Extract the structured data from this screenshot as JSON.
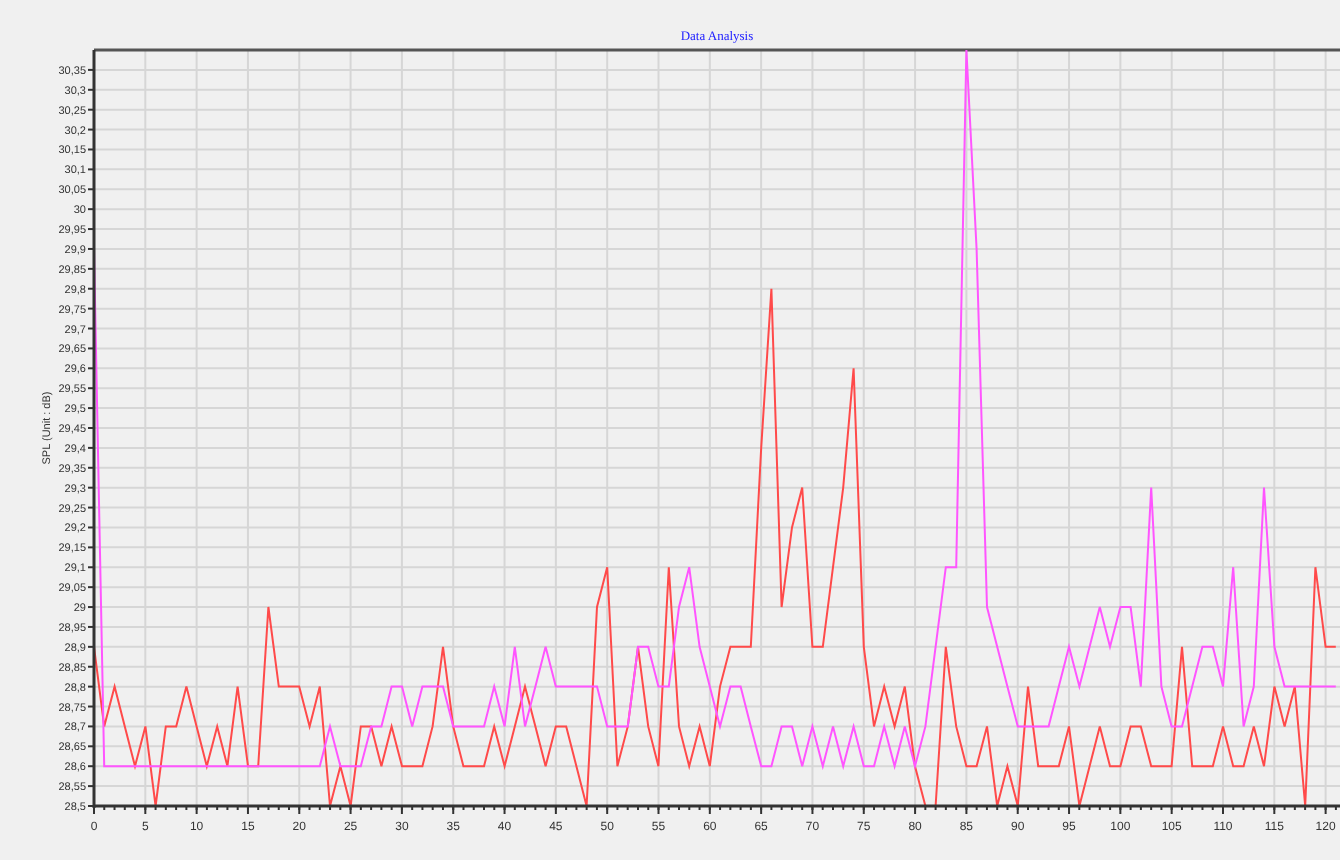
{
  "chart": {
    "chart_data": {
      "type": "line",
      "grid": true,
      "title": "Data Analysis",
      "ylabel": "SPL (Unit : dB)",
      "x": [
        0,
        1,
        2,
        3,
        4,
        5,
        6,
        7,
        8,
        9,
        10,
        11,
        12,
        13,
        14,
        15,
        16,
        17,
        18,
        19,
        20,
        21,
        22,
        23,
        24,
        25,
        26,
        27,
        28,
        29,
        30,
        31,
        32,
        33,
        34,
        35,
        36,
        37,
        38,
        39,
        40,
        41,
        42,
        43,
        44,
        45,
        46,
        47,
        48,
        49,
        50,
        51,
        52,
        53,
        54,
        55,
        56,
        57,
        58,
        59,
        60,
        61,
        62,
        63,
        64,
        65,
        66,
        67,
        68,
        69,
        70,
        71,
        72,
        73,
        74,
        75,
        76,
        77,
        78,
        79,
        80,
        81,
        82,
        83,
        84,
        85,
        86,
        87,
        88,
        89,
        90,
        91,
        92,
        93,
        94,
        95,
        96,
        97,
        98,
        99,
        100,
        101,
        102,
        103,
        104,
        105,
        106,
        107,
        108,
        109,
        110,
        111,
        112,
        113,
        114,
        115,
        116,
        117,
        118,
        119,
        120,
        121
      ],
      "series": [
        {
          "color": "#ff4a4a",
          "values": [
            28.9,
            28.7,
            28.8,
            28.7,
            28.6,
            28.7,
            28.5,
            28.7,
            28.7,
            28.8,
            28.7,
            28.6,
            28.7,
            28.6,
            28.8,
            28.6,
            28.6,
            29.0,
            28.8,
            28.8,
            28.8,
            28.7,
            28.8,
            28.5,
            28.6,
            28.5,
            28.7,
            28.7,
            28.6,
            28.7,
            28.6,
            28.6,
            28.6,
            28.7,
            28.9,
            28.7,
            28.6,
            28.6,
            28.6,
            28.7,
            28.6,
            28.7,
            28.8,
            28.7,
            28.6,
            28.7,
            28.7,
            28.6,
            28.5,
            29.0,
            29.1,
            28.6,
            28.7,
            28.9,
            28.7,
            28.6,
            29.1,
            28.7,
            28.6,
            28.7,
            28.6,
            28.8,
            28.9,
            28.9,
            28.9,
            29.4,
            29.8,
            29.0,
            29.2,
            29.3,
            28.9,
            28.9,
            29.1,
            29.3,
            29.6,
            28.9,
            28.7,
            28.8,
            28.7,
            28.8,
            28.6,
            28.5,
            28.5,
            28.9,
            28.7,
            28.6,
            28.6,
            28.7,
            28.5,
            28.6,
            28.5,
            28.8,
            28.6,
            28.6,
            28.6,
            28.7,
            28.5,
            28.6,
            28.7,
            28.6,
            28.6,
            28.7,
            28.7,
            28.6,
            28.6,
            28.6,
            28.9,
            28.6,
            28.6,
            28.6,
            28.7,
            28.6,
            28.6,
            28.7,
            28.6,
            28.8,
            28.7,
            28.8,
            28.5,
            29.1,
            28.9,
            28.9
          ]
        },
        {
          "color": "#ff55ff",
          "values": [
            29.9,
            28.6,
            28.6,
            28.6,
            28.6,
            28.6,
            28.6,
            28.6,
            28.6,
            28.6,
            28.6,
            28.6,
            28.6,
            28.6,
            28.6,
            28.6,
            28.6,
            28.6,
            28.6,
            28.6,
            28.6,
            28.6,
            28.6,
            28.7,
            28.6,
            28.6,
            28.6,
            28.7,
            28.7,
            28.8,
            28.8,
            28.7,
            28.8,
            28.8,
            28.8,
            28.7,
            28.7,
            28.7,
            28.7,
            28.8,
            28.7,
            28.9,
            28.7,
            28.8,
            28.9,
            28.8,
            28.8,
            28.8,
            28.8,
            28.8,
            28.7,
            28.7,
            28.7,
            28.9,
            28.9,
            28.8,
            28.8,
            29.0,
            29.1,
            28.9,
            28.8,
            28.7,
            28.8,
            28.8,
            28.7,
            28.6,
            28.6,
            28.7,
            28.7,
            28.6,
            28.7,
            28.6,
            28.7,
            28.6,
            28.7,
            28.6,
            28.6,
            28.7,
            28.6,
            28.7,
            28.6,
            28.7,
            28.9,
            29.1,
            29.1,
            30.4,
            29.9,
            29.0,
            28.9,
            28.8,
            28.7,
            28.7,
            28.7,
            28.7,
            28.8,
            28.9,
            28.8,
            28.9,
            29.0,
            28.9,
            29.0,
            29.0,
            28.8,
            29.3,
            28.8,
            28.7,
            28.7,
            28.8,
            28.9,
            28.9,
            28.8,
            29.1,
            28.7,
            28.8,
            29.3,
            28.9,
            28.8,
            28.8,
            28.8,
            28.8,
            28.8,
            28.8
          ]
        }
      ],
      "xlim": [
        0,
        121.4
      ],
      "ylim": [
        28.5,
        30.4
      ],
      "xticks": [
        0,
        5,
        10,
        15,
        20,
        25,
        30,
        35,
        40,
        45,
        50,
        55,
        60,
        65,
        70,
        75,
        80,
        85,
        90,
        95,
        100,
        105,
        110,
        115,
        120
      ],
      "yticks": [
        {
          "value": 28.5,
          "label": "28,5"
        },
        {
          "value": 28.55,
          "label": "28,55"
        },
        {
          "value": 28.6,
          "label": "28,6"
        },
        {
          "value": 28.65,
          "label": "28,65"
        },
        {
          "value": 28.7,
          "label": "28,7"
        },
        {
          "value": 28.75,
          "label": "28,75"
        },
        {
          "value": 28.8,
          "label": "28,8"
        },
        {
          "value": 28.85,
          "label": "28,85"
        },
        {
          "value": 28.9,
          "label": "28,9"
        },
        {
          "value": 28.95,
          "label": "28,95"
        },
        {
          "value": 29,
          "label": "29"
        },
        {
          "value": 29.05,
          "label": "29,05"
        },
        {
          "value": 29.1,
          "label": "29,1"
        },
        {
          "value": 29.15,
          "label": "29,15"
        },
        {
          "value": 29.2,
          "label": "29,2"
        },
        {
          "value": 29.25,
          "label": "29,25"
        },
        {
          "value": 29.3,
          "label": "29,3"
        },
        {
          "value": 29.35,
          "label": "29,35"
        },
        {
          "value": 29.4,
          "label": "29,4"
        },
        {
          "value": 29.45,
          "label": "29,45"
        },
        {
          "value": 29.5,
          "label": "29,5"
        },
        {
          "value": 29.55,
          "label": "29,55"
        },
        {
          "value": 29.6,
          "label": "29,6"
        },
        {
          "value": 29.65,
          "label": "29,65"
        },
        {
          "value": 29.7,
          "label": "29,7"
        },
        {
          "value": 29.75,
          "label": "29,75"
        },
        {
          "value": 29.8,
          "label": "29,8"
        },
        {
          "value": 29.85,
          "label": "29,85"
        },
        {
          "value": 29.9,
          "label": "29,9"
        },
        {
          "value": 29.95,
          "label": "29,95"
        },
        {
          "value": 30,
          "label": "30"
        },
        {
          "value": 30.05,
          "label": "30,05"
        },
        {
          "value": 30.1,
          "label": "30,1"
        },
        {
          "value": 30.15,
          "label": "30,15"
        },
        {
          "value": 30.2,
          "label": "30,2"
        },
        {
          "value": 30.25,
          "label": "30,25"
        },
        {
          "value": 30.3,
          "label": "30,3"
        },
        {
          "value": 30.35,
          "label": "30,35"
        }
      ]
    }
  }
}
